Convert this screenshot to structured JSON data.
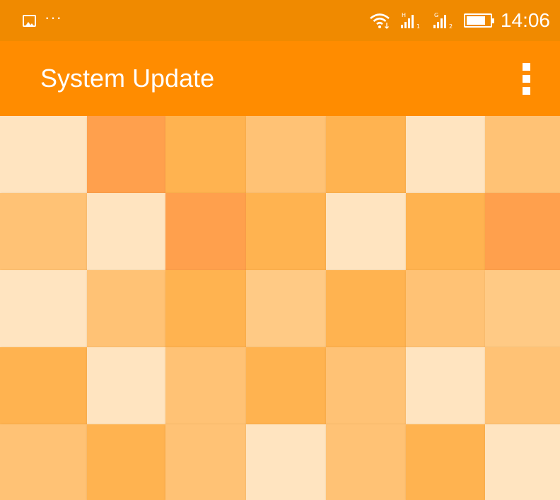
{
  "status_bar": {
    "notification_overflow": "···",
    "time": "14:06",
    "sim1_label": "H",
    "sim1_index": "1",
    "sim2_label": "G",
    "sim2_index": "2",
    "battery_level": 0.8
  },
  "app_bar": {
    "title": "System Update",
    "overflow_menu_icon": "more-vert-icon"
  },
  "colors": {
    "status_bar": "#F08A00",
    "app_bar": "#FF8C00"
  },
  "background_pattern": {
    "rows": [
      [
        "#FFE4C0",
        "#FFA04D",
        "#FFB350",
        "#FFC275",
        "#FFB350",
        "#FFE4C0",
        "#FFC275"
      ],
      [
        "#FFC275",
        "#FFE4C0",
        "#FFA04D",
        "#FFB350",
        "#FFE4C0",
        "#FFB350",
        "#FFA04D"
      ],
      [
        "#FFE4C0",
        "#FFC275",
        "#FFB350",
        "#FFCA85",
        "#FFB350",
        "#FFC275",
        "#FFCA85"
      ],
      [
        "#FFB350",
        "#FFE4C0",
        "#FFC275",
        "#FFB350",
        "#FFC275",
        "#FFE4C0",
        "#FFC275"
      ],
      [
        "#FFC275",
        "#FFB350",
        "#FFC275",
        "#FFE4C0",
        "#FFC275",
        "#FFB350",
        "#FFE4C0"
      ]
    ]
  }
}
